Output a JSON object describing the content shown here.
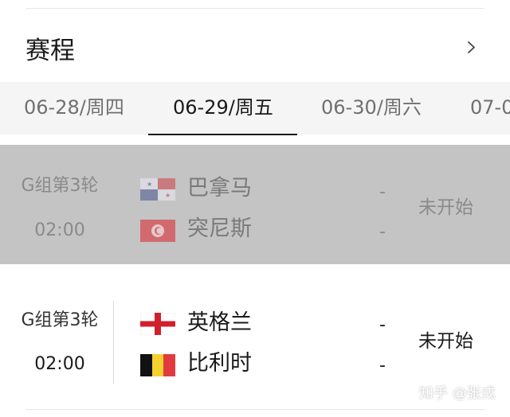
{
  "header": {
    "title": "赛程",
    "more_icon": "chevron-right-icon"
  },
  "tabs": [
    {
      "label": "06-28/周四",
      "active": false
    },
    {
      "label": "06-29/周五",
      "active": true
    },
    {
      "label": "06-30/周六",
      "active": false
    },
    {
      "label": "07-0",
      "active": false
    }
  ],
  "matches": [
    {
      "state": "dimmed",
      "round": "G组第3轮",
      "time": "02:00",
      "teams": [
        {
          "name": "巴拿马",
          "flag_icon": "panama-flag-icon",
          "score": "-"
        },
        {
          "name": "突尼斯",
          "flag_icon": "tunisia-flag-icon",
          "score": "-"
        }
      ],
      "status": "未开始"
    },
    {
      "state": "normal",
      "round": "G组第3轮",
      "time": "02:00",
      "teams": [
        {
          "name": "英格兰",
          "flag_icon": "england-flag-icon",
          "score": "-"
        },
        {
          "name": "比利时",
          "flag_icon": "belgium-flag-icon",
          "score": "-"
        }
      ],
      "status": "未开始"
    }
  ],
  "watermark": "知乎 @张戎",
  "colors": {
    "active_text": "#1a1a1a",
    "inactive_tab": "#707070",
    "tabbar_bg": "#f5f5f5",
    "dimmed_bg": "#c4c4c4"
  }
}
